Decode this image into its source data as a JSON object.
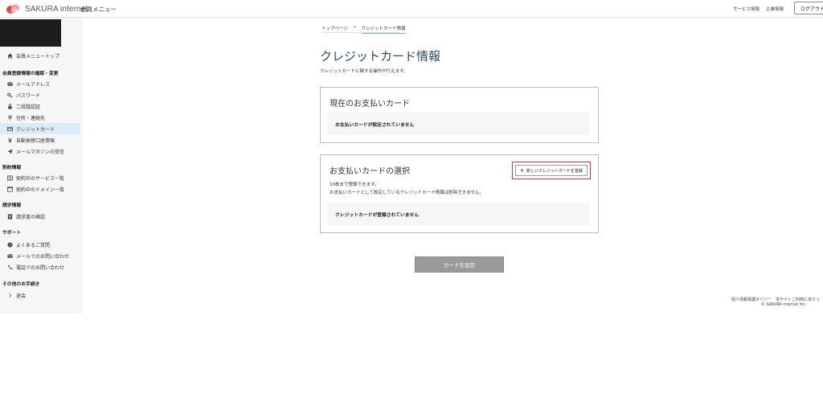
{
  "header": {
    "logo_text": "SAKURA internet",
    "member_menu": "会員メニュー",
    "links": [
      "サービス情報",
      "企業情報"
    ],
    "logout": "ログアウト"
  },
  "sidebar": {
    "top_item": "会員メニュートップ",
    "sections": [
      {
        "title": "会員登録情報の確認・変更",
        "items": [
          "メールアドレス",
          "パスワード",
          "二段階認証",
          "住所・連絡先",
          "クレジットカード",
          "自動振替口座情報",
          "メールマガジンの受信"
        ]
      },
      {
        "title": "契約情報",
        "items": [
          "契約中のサービス一覧",
          "契約中のドメイン一覧"
        ]
      },
      {
        "title": "請求情報",
        "items": [
          "請求書の確認"
        ]
      },
      {
        "title": "サポート",
        "items": [
          "よくあるご質問",
          "メールでのお問い合わせ",
          "電話でのお問い合わせ"
        ]
      },
      {
        "title": "その他のお手続き",
        "items": [
          "退会"
        ]
      }
    ]
  },
  "breadcrumb": {
    "home": "トップページ",
    "separator": ">",
    "current": "クレジットカード情報"
  },
  "main": {
    "title": "クレジットカード情報",
    "description": "クレジットカードに関する操作が行えます。",
    "current_card": {
      "title": "現在のお支払いカード",
      "message": "お支払いカードが設定されていません"
    },
    "select_card": {
      "title": "お支払いカードの選択",
      "add_button": "新しいクレジットカードを登録",
      "notes": [
        "10枚まで登録できます。",
        "お支払いカードとして設定しているクレジットカード情報は削除できません。"
      ],
      "message": "クレジットカードが登録されていません"
    },
    "set_button": "カードを設定"
  },
  "footer": {
    "links": "個人情報保護ポリシー　本サイトご利用にあたっ",
    "copyright": "© SAKURA internet Inc."
  },
  "colors": {
    "accent": "#2b4a66",
    "active_bg": "#d8edf7",
    "highlight_border": "#d9343a"
  }
}
